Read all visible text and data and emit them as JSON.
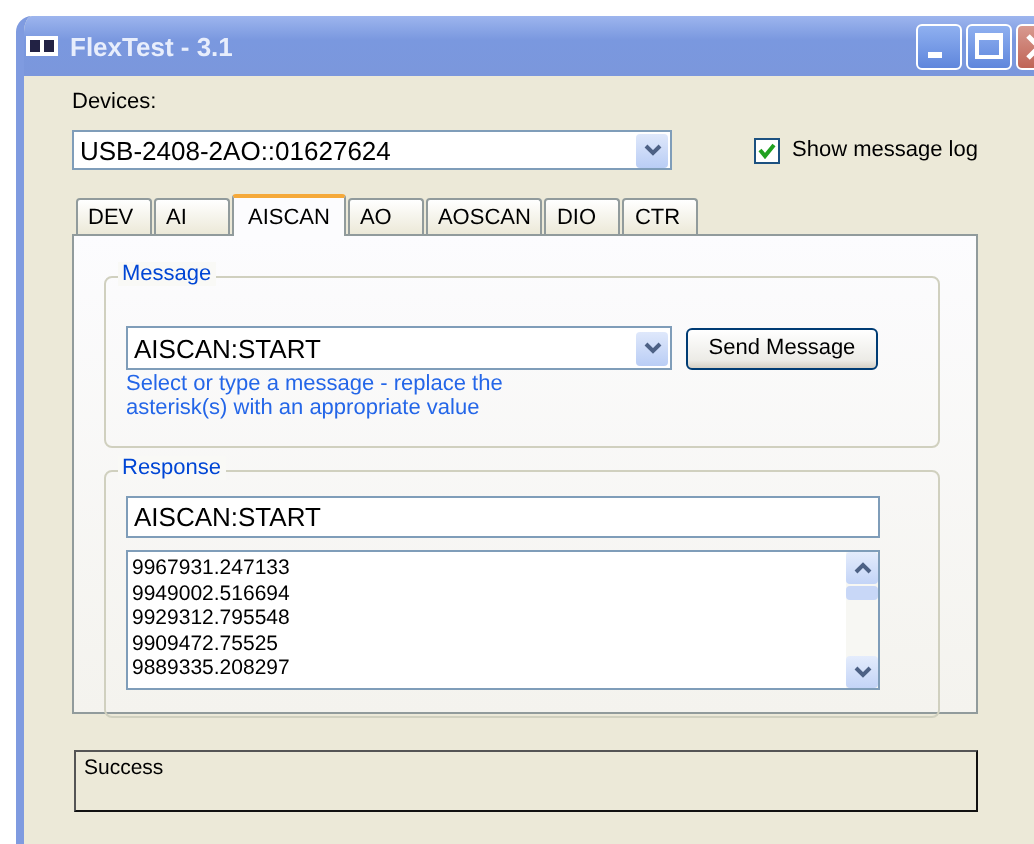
{
  "window": {
    "title": "FlexTest - 3.1"
  },
  "devices": {
    "label": "Devices:",
    "value": "USB-2408-2AO::01627624"
  },
  "show_message_log": {
    "label": "Show message log",
    "checked": true
  },
  "tabs": [
    {
      "label": "DEV",
      "selected": false
    },
    {
      "label": "AI",
      "selected": false
    },
    {
      "label": "AISCAN",
      "selected": true
    },
    {
      "label": "AO",
      "selected": false
    },
    {
      "label": "AOSCAN",
      "selected": false
    },
    {
      "label": "DIO",
      "selected": false
    },
    {
      "label": "CTR",
      "selected": false
    }
  ],
  "message": {
    "title": "Message",
    "value": "AISCAN:START",
    "button": "Send Message",
    "hint": "Select or type a message - replace the asterisk(s) with an appropriate value"
  },
  "response": {
    "title": "Response",
    "value": "AISCAN:START",
    "lines": [
      "9967931.247133",
      "9949002.516694",
      "9929312.795548",
      "9909472.75525",
      "9889335.208297"
    ]
  },
  "status": "Success"
}
